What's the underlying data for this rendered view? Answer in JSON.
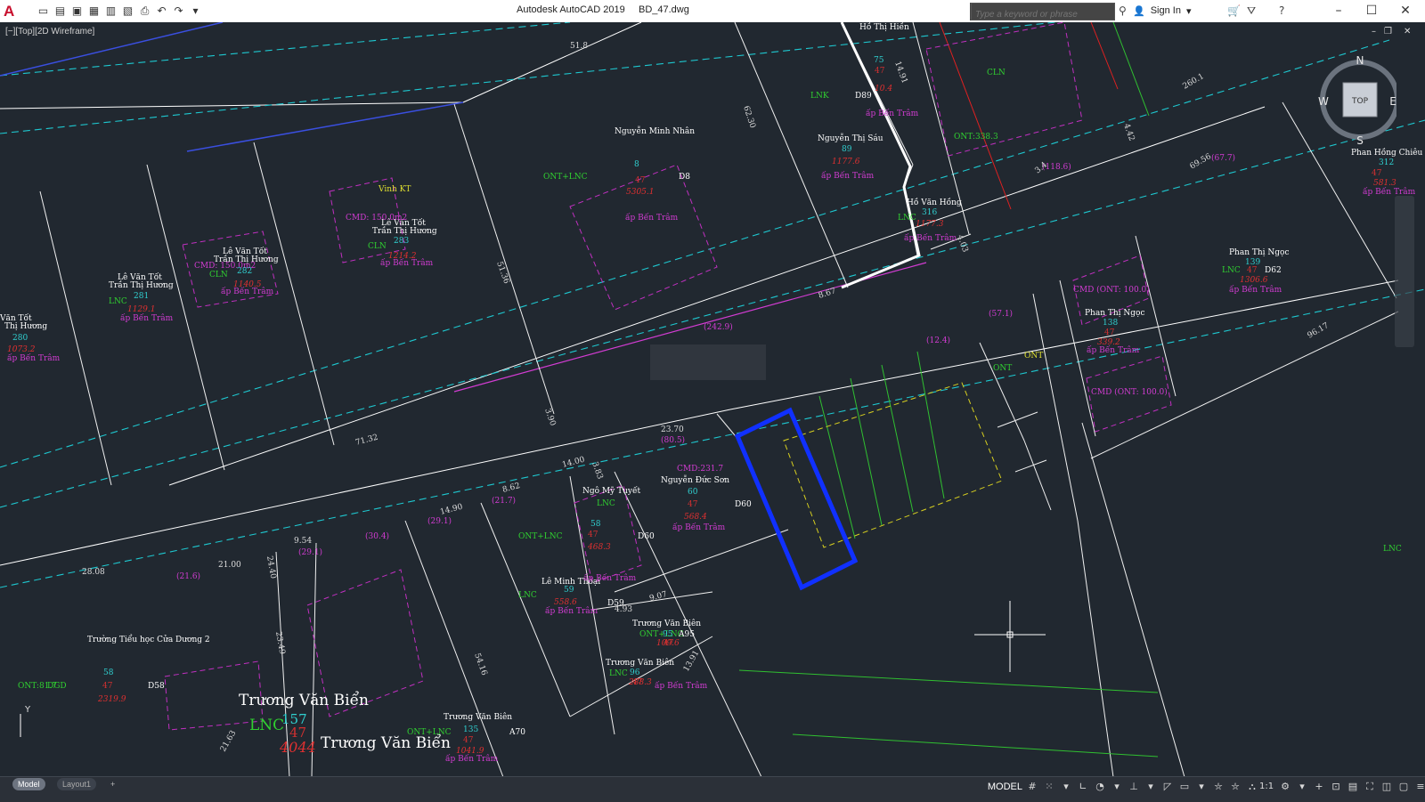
{
  "app": {
    "title": "Autodesk AutoCAD 2019",
    "file": "BD_47.dwg",
    "search_placeholder": "Type a keyword or phrase",
    "sign_in": "Sign In"
  },
  "viewport": {
    "label": "[−][Top][2D Wireframe]"
  },
  "viewcube": {
    "n": "N",
    "s": "S",
    "e": "E",
    "w": "W",
    "face": "TOP"
  },
  "tabs": {
    "model": "Model",
    "layout1": "Layout1",
    "add": "+"
  },
  "status": {
    "model": "MODEL",
    "scale": "1:1"
  },
  "drawing": {
    "dimensions": [
      "51.8",
      "62.30",
      "51.36",
      "3.90",
      "71.32",
      "8.67",
      "(242.9)",
      "23.70",
      "(80.5)",
      "14.00",
      "3.83",
      "8.62",
      "(21.7)",
      "14.90",
      "(29.1)",
      "9.54",
      "(29.1)",
      "(30.4)",
      "21.00",
      "(21.6)",
      "28.08",
      "24.40",
      "23.49",
      "54.16",
      "21.63",
      "9.07",
      "4.93",
      "13.91",
      "4.03",
      "14.91",
      "260.1",
      "4.42",
      "(118.6)",
      "69.56",
      "(67.7)",
      "96.17",
      "(57.1)",
      "(12.4)",
      "3.4"
    ],
    "owners": [
      "Hồ Thị Hiền",
      "Nguyễn Minh Nhân",
      "Nguyễn Thị Sáu",
      "Hồ Văn Hồng",
      "Vinh KT",
      "Lê Văn Tốt",
      "Trần Thị Hương",
      "Lê Văn Tốt",
      "Trần Thị Hương",
      "Lê Văn Tốt",
      "Trần Thị Hương",
      "Văn Tốt",
      "Thị Hương",
      "Phan Hồng Chiêu",
      "Phan Thị Ngọc",
      "Phan Thị Ngọc",
      "Ngô Mỹ Tuyết",
      "Nguyễn Đức Sơn",
      "Lê Minh Thoại",
      "Trương Văn Biên",
      "Trương Văn Biên",
      "Trường Tiểu học Cửa Dương 2",
      "Trương Văn Biển",
      "Trương Văn Biển",
      "Trương Văn Biên"
    ],
    "codes": [
      "ONT+LNC",
      "LNK",
      "LNC",
      "CLN",
      "CLN",
      "CLN",
      "ONT:338.3",
      "ONT:81.7",
      "LNC",
      "ONT+LNC",
      "LNC",
      "ONT+LNC",
      "LNC",
      "DGD",
      "LNC",
      "ONT+LNC",
      "ONT",
      "ONT",
      "LNC",
      "LNC",
      "LNC",
      "CMD: 150.0m2",
      "CMD: 150.0m2",
      "CMD:231.7",
      "CMD (ONT: 100.0)",
      "CMD (ONT: 100.0)"
    ],
    "parcel_numbers": [
      "8",
      "75",
      "89",
      "316",
      "283",
      "282",
      "281",
      "280",
      "312",
      "139",
      "138",
      "60",
      "58",
      "59",
      "95",
      "96",
      "157",
      "135",
      "58"
    ],
    "sheet_numbers": [
      "47",
      "47",
      "47",
      "47",
      "47",
      "47",
      "47",
      "47",
      "47",
      "47",
      "47",
      "47"
    ],
    "areas": [
      "5305.1",
      "10.4",
      "1177.6",
      "1177.3",
      "1214.2",
      "1140.5",
      "1129.1",
      "1073.2",
      "581.3",
      "1306.6",
      "339.2",
      "568.4",
      "468.3",
      "558.6",
      "109.6",
      "288.3",
      "4044",
      "1041.9",
      "2319.9"
    ],
    "locations": [
      "ấp Bến Trâm",
      "ấp Bến Trâm",
      "ấp Bến Trâm",
      "ấp Bến Trâm",
      "ấp Bến Trâm",
      "ấp Bến Trâm",
      "ấp Bến Trâm",
      "ấp Bến Trâm",
      "ấp Bến Trâm",
      "ấp Bến Trâm",
      "ấp Bến Trâm",
      "ấp Bến Trâm",
      "ấp Bến Trâm",
      "ấp Bến Trâm",
      "ấp Bến Trâm",
      "ấp Bến Trâm"
    ],
    "block_ids": [
      "D8",
      "D89",
      "D62",
      "D60",
      "D59",
      "D58",
      "A95",
      "A70",
      "D60"
    ]
  }
}
